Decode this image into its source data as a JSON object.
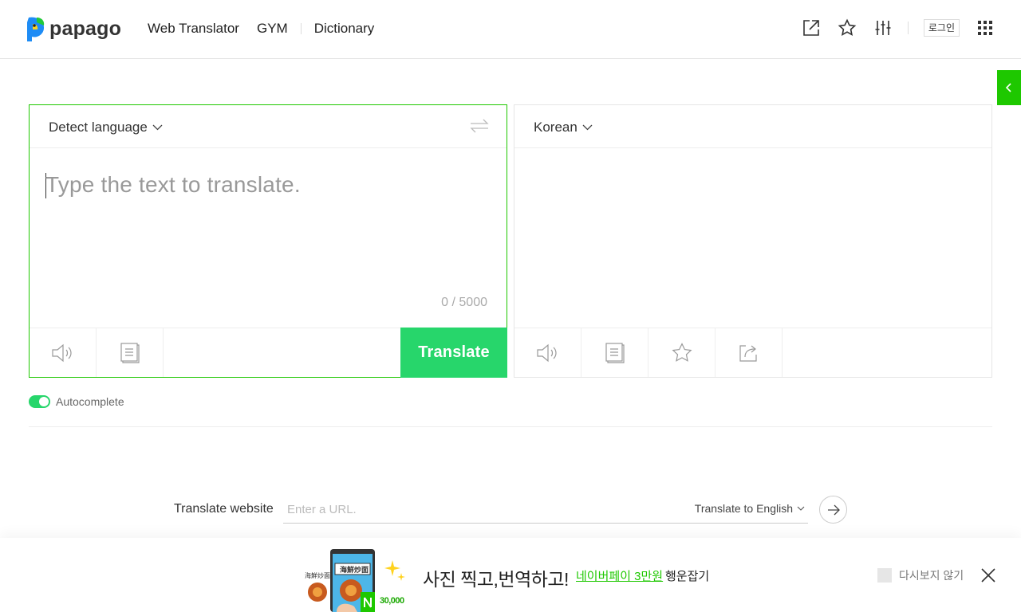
{
  "header": {
    "logo_text": "papago",
    "nav": [
      "Web Translator",
      "GYM",
      "Dictionary"
    ],
    "login_label": "로그인"
  },
  "icons": {
    "share": "external-link-icon",
    "favorites": "star-icon",
    "settings": "sliders-icon",
    "apps": "grid-icon",
    "side_tab": "chevron-left-icon"
  },
  "source": {
    "language": "Detect language",
    "placeholder": "Type the text to translate.",
    "counter": "0 / 5000",
    "translate_label": "Translate"
  },
  "target": {
    "language": "Korean"
  },
  "autocomplete": {
    "label": "Autocomplete",
    "enabled": true
  },
  "website": {
    "label": "Translate website",
    "placeholder": "Enter a URL.",
    "target_language": "Translate to English"
  },
  "banner": {
    "image_caption": "海鮮炒面",
    "image_price": "30,000",
    "title": "사진 찍고,번역하고!",
    "link": "네이버페이 3만원",
    "tail": "행운잡기",
    "dont_show": "다시보지 않기"
  },
  "colors": {
    "accent": "#1ec800",
    "translate_button": "#27d66b"
  }
}
